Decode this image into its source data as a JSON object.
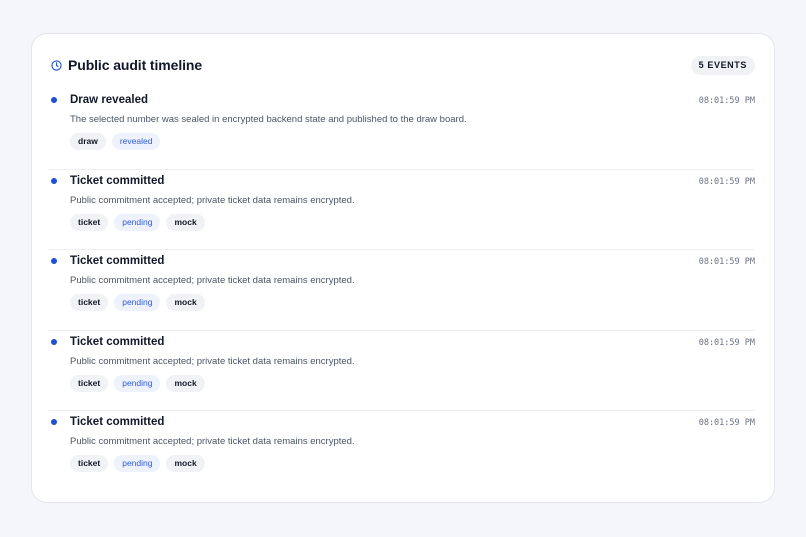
{
  "panel": {
    "title": "Public audit timeline",
    "event_count_label": "5 EVENTS",
    "icon": "clock-icon",
    "accent_color": "#1d4ed8"
  },
  "events": [
    {
      "title": "Draw revealed",
      "description": "The selected number was sealed in encrypted backend state and published to the draw board.",
      "time": "08:01:59 PM",
      "tags": [
        {
          "label": "draw",
          "style": "neutral"
        },
        {
          "label": "revealed",
          "style": "blue"
        }
      ]
    },
    {
      "title": "Ticket committed",
      "description": "Public commitment accepted; private ticket data remains encrypted.",
      "time": "08:01:59 PM",
      "tags": [
        {
          "label": "ticket",
          "style": "neutral"
        },
        {
          "label": "pending",
          "style": "blue"
        },
        {
          "label": "mock",
          "style": "neutral"
        }
      ]
    },
    {
      "title": "Ticket committed",
      "description": "Public commitment accepted; private ticket data remains encrypted.",
      "time": "08:01:59 PM",
      "tags": [
        {
          "label": "ticket",
          "style": "neutral"
        },
        {
          "label": "pending",
          "style": "blue"
        },
        {
          "label": "mock",
          "style": "neutral"
        }
      ]
    },
    {
      "title": "Ticket committed",
      "description": "Public commitment accepted; private ticket data remains encrypted.",
      "time": "08:01:59 PM",
      "tags": [
        {
          "label": "ticket",
          "style": "neutral"
        },
        {
          "label": "pending",
          "style": "blue"
        },
        {
          "label": "mock",
          "style": "neutral"
        }
      ]
    },
    {
      "title": "Ticket committed",
      "description": "Public commitment accepted; private ticket data remains encrypted.",
      "time": "08:01:59 PM",
      "tags": [
        {
          "label": "ticket",
          "style": "neutral"
        },
        {
          "label": "pending",
          "style": "blue"
        },
        {
          "label": "mock",
          "style": "neutral"
        }
      ]
    }
  ]
}
